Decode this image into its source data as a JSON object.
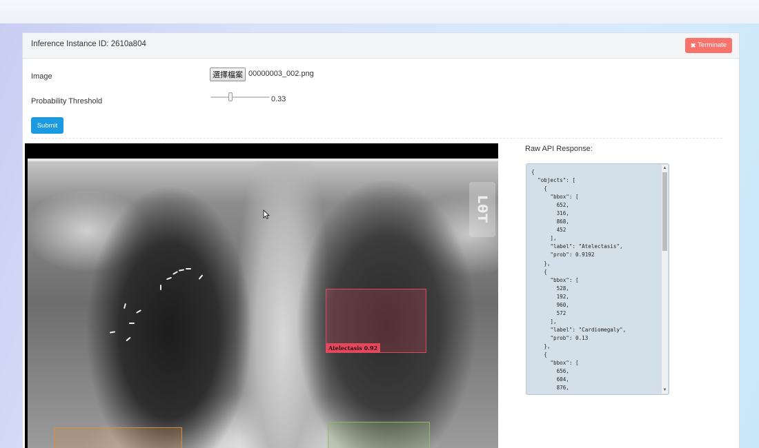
{
  "header": {
    "title": "Inference Instance ID: 2610a804",
    "terminate_label": "Terminate"
  },
  "form": {
    "image_label": "Image",
    "file_button_label": "選擇檔案",
    "file_name": "00000003_002.png",
    "threshold_label": "Probability Threshold",
    "threshold_value": "0.33",
    "threshold_fraction": 0.33,
    "submit_label": "Submit"
  },
  "viewer": {
    "marker_text": "LθT",
    "detections": [
      {
        "label_text": "Atelectasis 0.92",
        "color": "#e2495f",
        "show_label": true
      },
      {
        "label_text": "",
        "color": "#e08a3c",
        "show_label": false
      },
      {
        "label_text": "",
        "color": "#8fb86a",
        "show_label": false
      }
    ]
  },
  "raw": {
    "title": "Raw API Response:",
    "lines": [
      "{",
      "  \"objects\": [",
      "    {",
      "      \"bbox\": [",
      "        652,",
      "        316,",
      "        868,",
      "        452",
      "      ],",
      "      \"label\": \"Atelectasis\",",
      "      \"prob\": 0.9192",
      "    },",
      "    {",
      "      \"bbox\": [",
      "        528,",
      "        192,",
      "        960,",
      "        572",
      "      ],",
      "      \"label\": \"Cardiomegaly\",",
      "      \"prob\": 0.13",
      "    },",
      "    {",
      "      \"bbox\": [",
      "        656,",
      "        604,",
      "        876,"
    ]
  },
  "colors": {
    "terminate": "#f7736b",
    "submit": "#1b9ae0",
    "raw_background": "#d3e0e9"
  }
}
